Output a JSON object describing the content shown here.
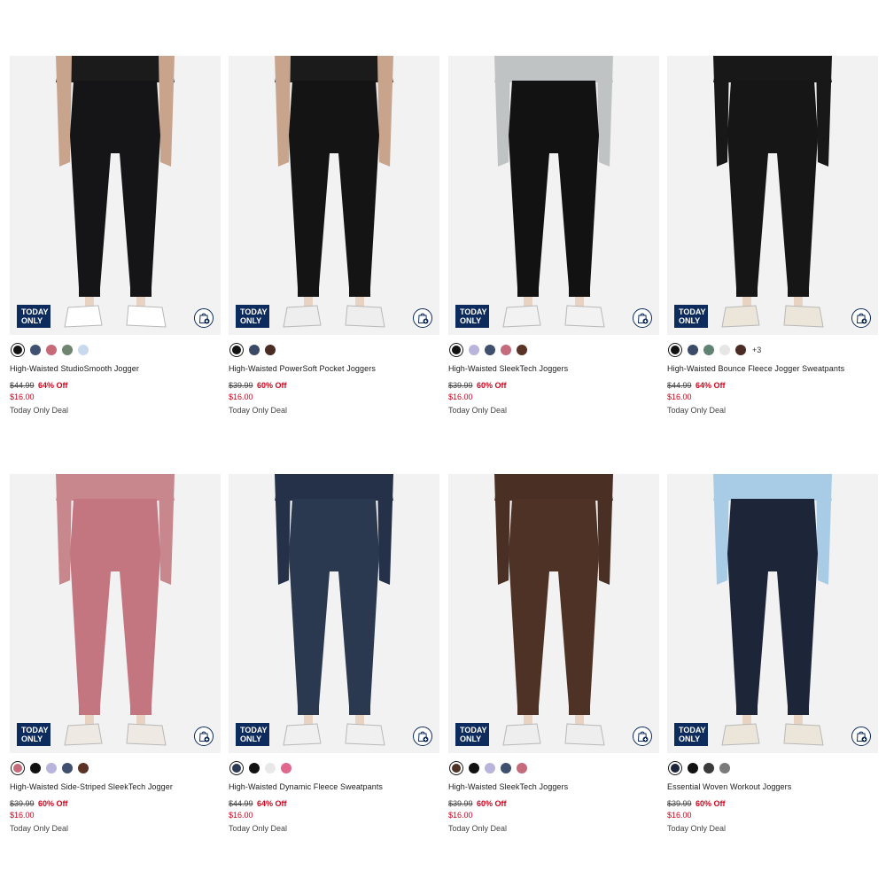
{
  "products": [
    {
      "name": "High-Waisted StudioSmooth Jogger",
      "badge": [
        "TODAY",
        "ONLY"
      ],
      "pant_color": "#151518",
      "top_color": "#1b1b1b",
      "top_style": "crop",
      "shoe_color": "#ffffff",
      "swatches": [
        "#111111",
        "#3f5070",
        "#c76a78",
        "#6f8570",
        "#c8d9ee"
      ],
      "more": "",
      "original_price": "$44.99",
      "discount": "64% Off",
      "sale_price": "$16.00",
      "deal": "Today Only Deal"
    },
    {
      "name": "High-Waisted PowerSoft Pocket Joggers",
      "badge": [
        "TODAY",
        "ONLY"
      ],
      "pant_color": "#141414",
      "top_color": "#1b1b1b",
      "top_style": "crop",
      "shoe_color": "#eeeeee",
      "swatches": [
        "#111111",
        "#3b4a66",
        "#4a2c24"
      ],
      "more": "",
      "original_price": "$39.99",
      "discount": "60% Off",
      "sale_price": "$16.00",
      "deal": "Today Only Deal"
    },
    {
      "name": "High-Waisted SleekTech Joggers",
      "badge": [
        "TODAY",
        "ONLY"
      ],
      "pant_color": "#121212",
      "top_color": "#bfc3c4",
      "top_style": "sweater",
      "shoe_color": "#f2f2f2",
      "swatches": [
        "#111111",
        "#b9b4dc",
        "#3f4f6e",
        "#c46b7c",
        "#5a3326"
      ],
      "more": "",
      "original_price": "$39.99",
      "discount": "60% Off",
      "sale_price": "$16.00",
      "deal": "Today Only Deal"
    },
    {
      "name": "High-Waisted Bounce Fleece Jogger Sweatpants",
      "badge": [
        "TODAY",
        "ONLY"
      ],
      "pant_color": "#161616",
      "top_color": "#181818",
      "top_style": "sweater",
      "shoe_color": "#ece6da",
      "swatches": [
        "#111111",
        "#3b4a66",
        "#5f8373",
        "#e6e6e6",
        "#4a2c24"
      ],
      "more": "+3",
      "original_price": "$44.99",
      "discount": "64% Off",
      "sale_price": "$16.00",
      "deal": "Today Only Deal"
    },
    {
      "name": "High-Waisted Side-Striped SleekTech Jogger",
      "badge": [
        "TODAY",
        "ONLY"
      ],
      "pant_color": "#c47680",
      "top_color": "#c8868d",
      "top_style": "sweater",
      "shoe_color": "#efe9e3",
      "swatches": [
        "#c46b7c",
        "#111111",
        "#b9b4dc",
        "#3f4f6e",
        "#5a3326"
      ],
      "more": "",
      "original_price": "$39.99",
      "discount": "60% Off",
      "sale_price": "$16.00",
      "deal": "Today Only Deal"
    },
    {
      "name": "High-Waisted Dynamic Fleece Sweatpants",
      "badge": [
        "TODAY",
        "ONLY"
      ],
      "pant_color": "#2a3850",
      "top_color": "#243148",
      "top_style": "sweater",
      "shoe_color": "#f0f0f0",
      "swatches": [
        "#2c3a55",
        "#111111",
        "#e8e8e8",
        "#e0678e"
      ],
      "more": "",
      "original_price": "$44.99",
      "discount": "64% Off",
      "sale_price": "$16.00",
      "deal": "Today Only Deal"
    },
    {
      "name": "High-Waisted SleekTech Joggers",
      "badge": [
        "TODAY",
        "ONLY"
      ],
      "pant_color": "#4e3226",
      "top_color": "#4a3024",
      "top_style": "sweater",
      "shoe_color": "#eeeeee",
      "swatches": [
        "#4e3226",
        "#111111",
        "#b9b4dc",
        "#3f4f6e",
        "#c46b7c"
      ],
      "more": "",
      "original_price": "$39.99",
      "discount": "60% Off",
      "sale_price": "$16.00",
      "deal": "Today Only Deal"
    },
    {
      "name": "Essential Woven Workout Joggers",
      "badge": [
        "TODAY",
        "ONLY"
      ],
      "pant_color": "#1c2638",
      "top_color": "#a9cce6",
      "top_style": "sweater",
      "shoe_color": "#ece6da",
      "swatches": [
        "#1c2638",
        "#111111",
        "#3a3a3a",
        "#7a7a7a"
      ],
      "more": "",
      "original_price": "$39.99",
      "discount": "60% Off",
      "sale_price": "$16.00",
      "deal": "Today Only Deal"
    }
  ]
}
